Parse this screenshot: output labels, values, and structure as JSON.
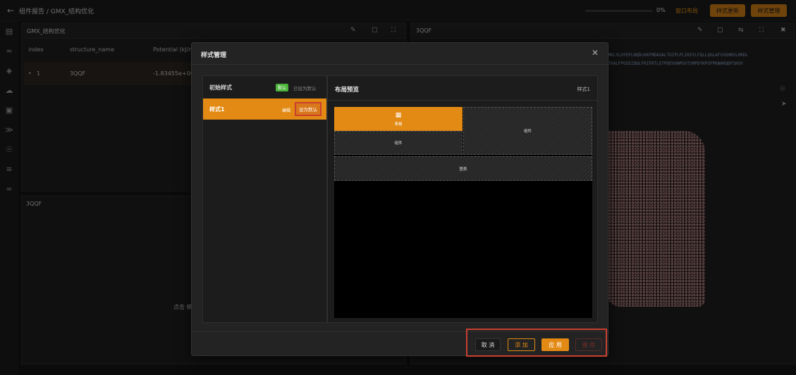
{
  "topbar": {
    "back_icon": "arrow-left-icon",
    "breadcrumb": "组件报告 / GMX_结构优化",
    "progress_value": 0,
    "progress_text": "0%",
    "window_layout": "窗口布局",
    "style_update": "样式更新",
    "style_manage": "样式管理"
  },
  "sidebar_icons": [
    "list-icon",
    "dna-icon",
    "molecule-icon",
    "cloud-icon",
    "image-icon",
    "pipeline-icon",
    "target-icon",
    "sliders-icon",
    "link-icon"
  ],
  "left_panel": {
    "title": "GMX_结构优化",
    "columns": [
      "index",
      "structure_name",
      "Potential (kJ/m"
    ],
    "row": {
      "index": "1",
      "structure_name": "3QQF",
      "potential": "-1.83455e+06"
    }
  },
  "lower_panel": {
    "title": "3QQF",
    "hint": "点击 模"
  },
  "right_panel": {
    "title": "3QQF",
    "seq_line_1": "TKTEMKLYLVFEFLHQDLKKFMDASALTGIPLPLIKSYLFQLLQGLAFCHSHRVLHRDL",
    "seq_line_2": "LAENTRALFPGSEIDQLFRIFRTLGTPDEVVWPGVTSMPDYKPSFPKWARQDFSKVV"
  },
  "modal": {
    "title": "样式管理",
    "styles": [
      {
        "name": "初始样式",
        "badge": "默认",
        "status": "已设为默认"
      },
      {
        "name": "样式1",
        "edit": "编辑",
        "action": "设为默认"
      }
    ],
    "preview": {
      "title": "布局预览",
      "style_name": "样式1",
      "blocks": {
        "table": "表格",
        "component_a": "组件",
        "component_b": "组件",
        "chart": "图表"
      }
    },
    "buttons": {
      "cancel": "取 消",
      "add": "添 加",
      "apply": "应 用",
      "delete": "删 除"
    }
  },
  "colors": {
    "accent": "#e28a14",
    "success": "#4bb53a",
    "highlight": "#c9402f"
  }
}
